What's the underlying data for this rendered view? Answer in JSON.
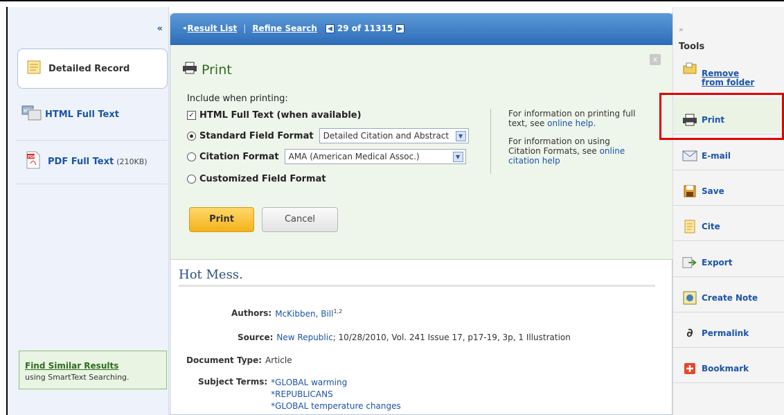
{
  "navigation": {
    "result_list": "Result List",
    "refine_search": "Refine Search",
    "position": "29 of 11315",
    "collapse_left": "«",
    "expand_right": "»"
  },
  "left_sidebar": {
    "items": [
      {
        "label": "Detailed Record",
        "icon": "detailed-record-icon"
      },
      {
        "label": "HTML Full Text",
        "icon": "html-full-text-icon"
      },
      {
        "label": "PDF Full Text",
        "size": "(210KB)",
        "icon": "pdf-icon"
      }
    ],
    "find_similar": {
      "title": "Find Similar Results",
      "subtitle": "using SmartText Searching."
    }
  },
  "print_panel": {
    "title": "Print",
    "include_label": "Include when printing:",
    "html_full_text_option": "HTML Full Text (when available)",
    "standard_field_format": "Standard Field Format",
    "standard_select_value": "Detailed Citation and Abstract",
    "citation_format": "Citation Format",
    "citation_select_value": "AMA (American Medical Assoc.)",
    "customized_field_format": "Customized Field Format",
    "info_1_text": "For information on printing full text, see",
    "info_1_link": "online help.",
    "info_2_text": "For information on using Citation Formats, see",
    "info_2_link": "online citation help",
    "print_button": "Print",
    "cancel_button": "Cancel",
    "close": "x"
  },
  "record": {
    "title": "Hot Mess.",
    "authors_label": "Authors:",
    "author": "McKibben, Bill",
    "author_sup": "1,2",
    "source_label": "Source:",
    "source_link": "New Republic",
    "source_rest": "; 10/28/2010, Vol. 241 Issue 17, p17-19, 3p, 1 Illustration",
    "doctype_label": "Document Type:",
    "doctype": "Article",
    "subject_label": "Subject Terms:",
    "subject_terms": [
      "*GLOBAL warming",
      "*REPUBLICANS",
      "*GLOBAL temperature changes"
    ]
  },
  "tools": {
    "title": "Tools",
    "items": [
      {
        "label": "Remove from folder",
        "icon": "folder-icon"
      },
      {
        "label": "Print",
        "icon": "printer-icon"
      },
      {
        "label": "E-mail",
        "icon": "email-icon"
      },
      {
        "label": "Save",
        "icon": "save-icon"
      },
      {
        "label": "Cite",
        "icon": "cite-icon"
      },
      {
        "label": "Export",
        "icon": "export-icon"
      },
      {
        "label": "Create Note",
        "icon": "note-icon"
      },
      {
        "label": "Permalink",
        "icon": "link-icon"
      },
      {
        "label": "Bookmark",
        "icon": "bookmark-icon"
      }
    ]
  },
  "colors": {
    "accent_blue": "#2d6cb8",
    "print_panel_bg": "#eef5ea",
    "print_button": "#f3b21c",
    "highlight": "#e00000"
  }
}
